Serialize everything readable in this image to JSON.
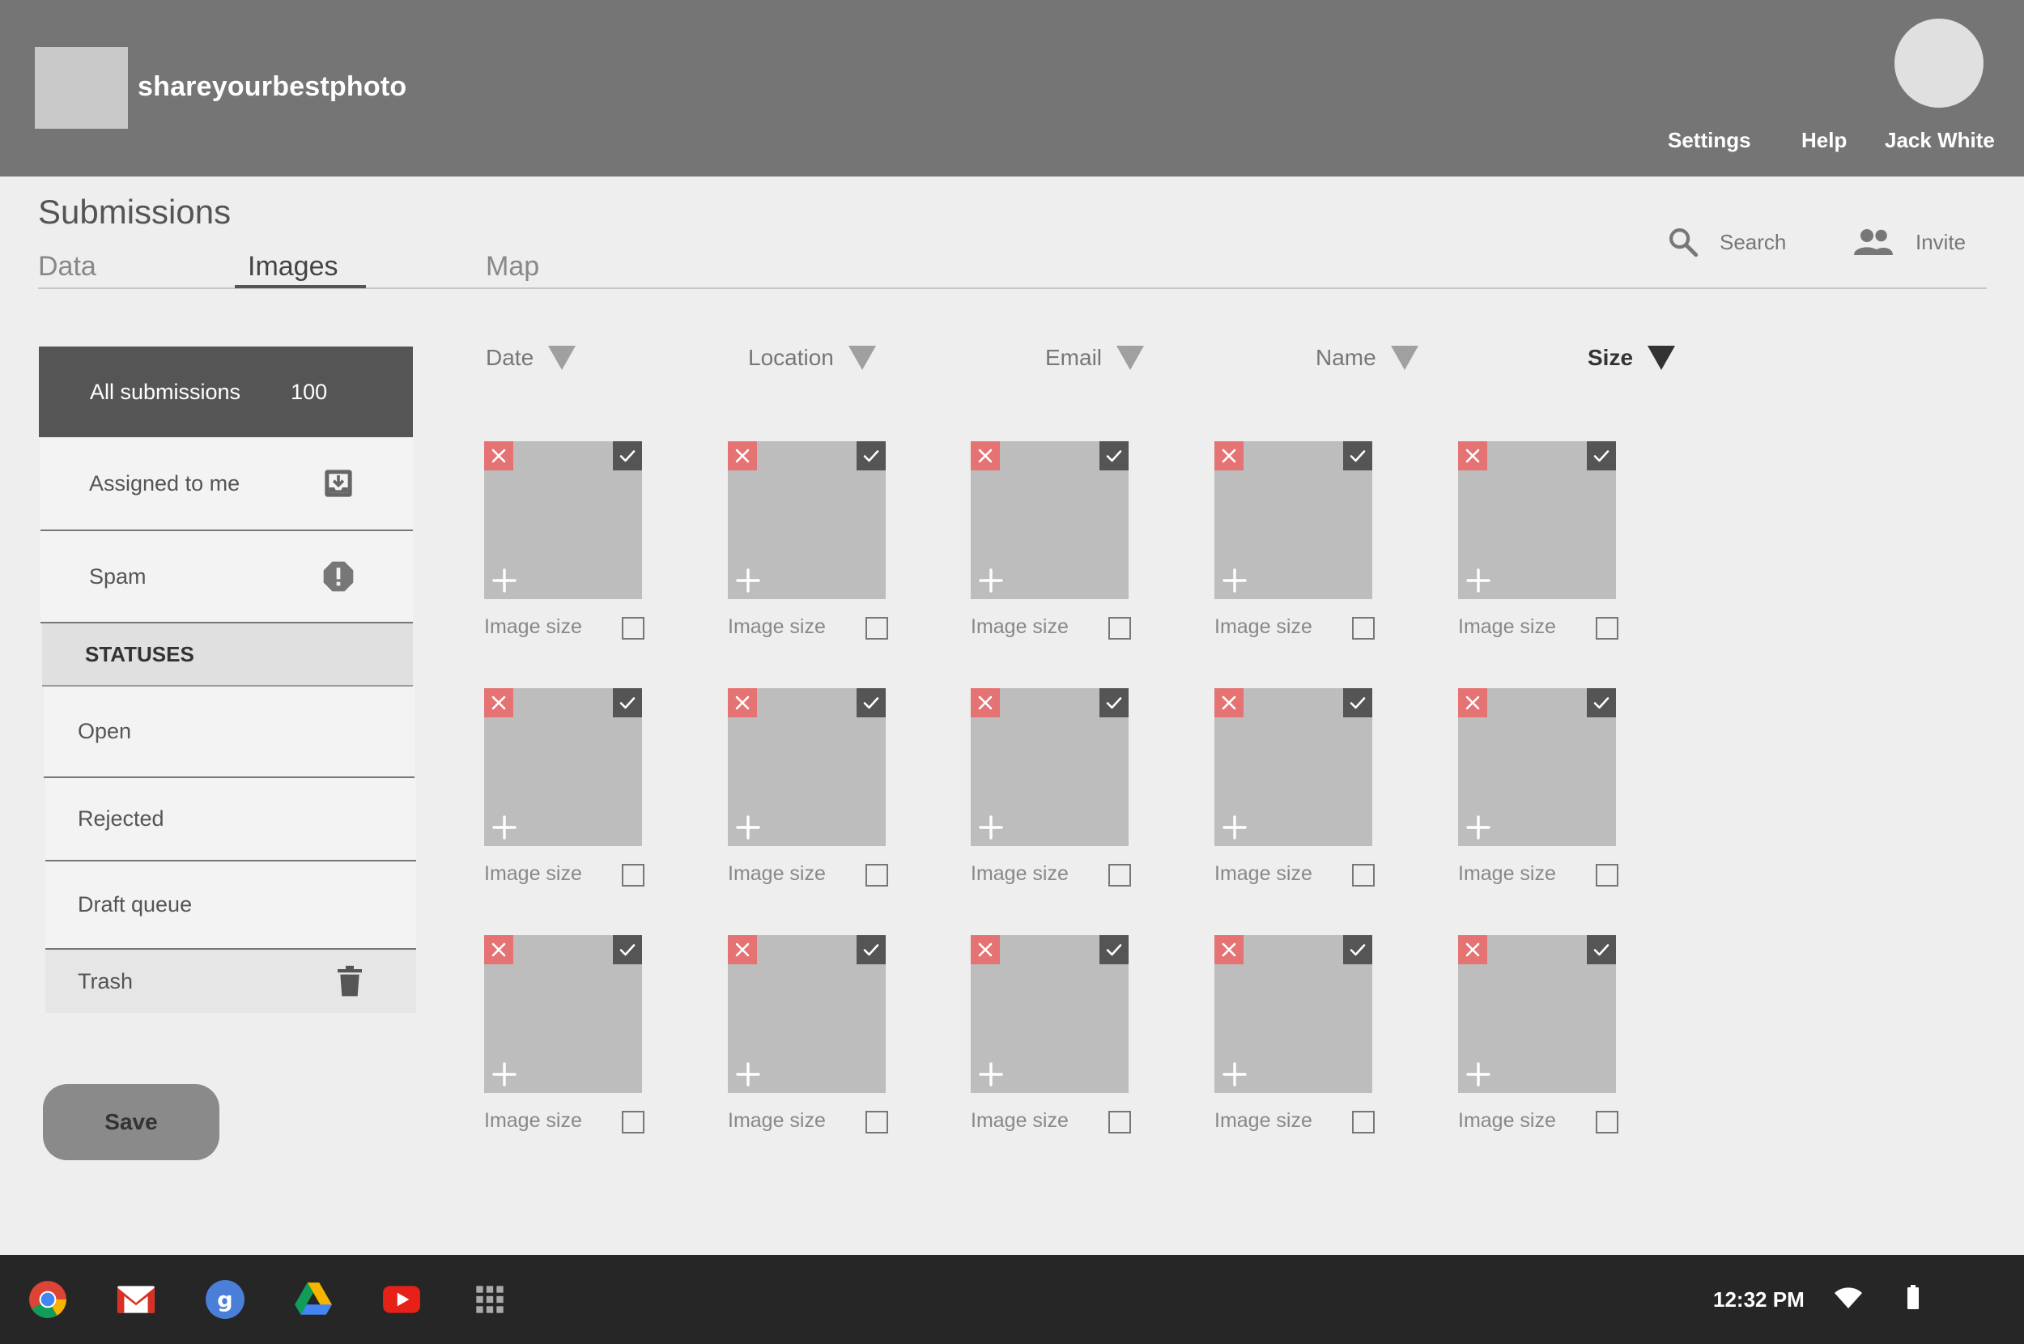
{
  "header": {
    "site_name": "shareyourbestphoto",
    "nav": [
      "Settings",
      "Help",
      "Jack White"
    ]
  },
  "page": {
    "title": "Submissions",
    "tabs": [
      "Data",
      "Images",
      "Map"
    ],
    "active_tab": "Images",
    "search_label": "Search",
    "invite_label": "Invite"
  },
  "sidebar": {
    "all_label": "All submissions",
    "all_count": "100",
    "assigned_label": "Assigned to me",
    "spam_label": "Spam",
    "statuses_heading": "STATUSES",
    "statuses": [
      "Open",
      "Rejected",
      "Draft queue"
    ],
    "trash_label": "Trash",
    "save_label": "Save"
  },
  "filters": [
    "Date",
    "Location",
    "Email",
    "Name",
    "Size"
  ],
  "active_filter": "Size",
  "image_label": "Image size",
  "colors": {
    "header_bg": "#757575",
    "sidebar_active": "#555555",
    "reject": "#e57373",
    "approve": "#555555",
    "thumb": "#bdbdbd",
    "taskbar": "#262626"
  },
  "taskbar": {
    "apps": [
      "chrome-icon",
      "gmail-icon",
      "google-plus-icon",
      "drive-icon",
      "youtube-icon",
      "apps-launcher-icon"
    ],
    "time": "12:32 PM"
  }
}
